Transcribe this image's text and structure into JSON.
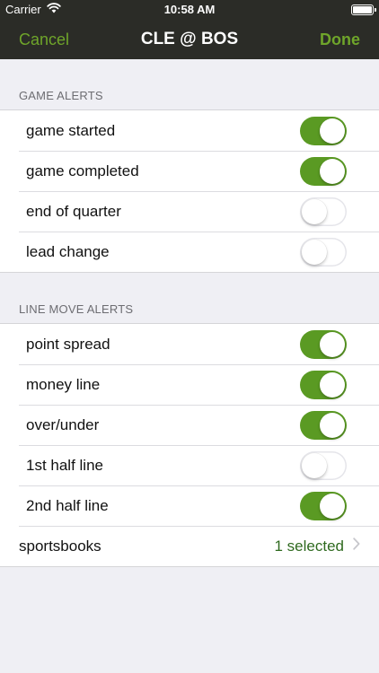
{
  "status_bar": {
    "carrier": "Carrier",
    "time": "10:58 AM"
  },
  "nav": {
    "cancel_label": "Cancel",
    "title": "CLE @ BOS",
    "done_label": "Done"
  },
  "game_alerts": {
    "header": "GAME ALERTS",
    "items": [
      {
        "label": "game started",
        "on": true
      },
      {
        "label": "game completed",
        "on": true
      },
      {
        "label": "end of quarter",
        "on": false
      },
      {
        "label": "lead change",
        "on": false
      }
    ]
  },
  "line_move_alerts": {
    "header": "LINE MOVE ALERTS",
    "items": [
      {
        "label": "point spread",
        "on": true
      },
      {
        "label": "money line",
        "on": true
      },
      {
        "label": "over/under",
        "on": true
      },
      {
        "label": "1st half line",
        "on": false
      },
      {
        "label": "2nd half line",
        "on": true
      }
    ],
    "sportsbooks": {
      "label": "sportsbooks",
      "value": "1 selected"
    }
  },
  "colors": {
    "accent": "#6fa52a",
    "toggle_on": "#5a9a23",
    "nav_background": "#2b2c27"
  },
  "icons": {
    "wifi": "wifi-icon",
    "battery": "battery-icon",
    "chevron": "chevron-right-icon"
  }
}
